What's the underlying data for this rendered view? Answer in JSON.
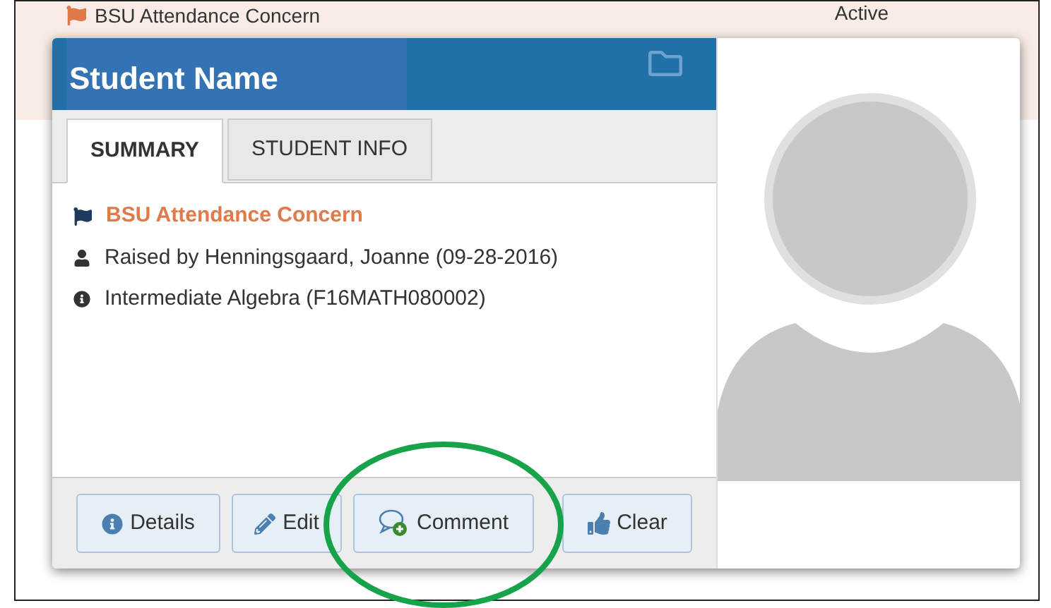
{
  "background_row": {
    "title": "BSU Attendance Concern",
    "status": "Active"
  },
  "popup": {
    "title": "Student Name",
    "tabs": [
      {
        "label": "SUMMARY",
        "selected": true
      },
      {
        "label": "STUDENT INFO",
        "selected": false
      }
    ],
    "summary": [
      {
        "kind": "flag",
        "text": "BSU Attendance Concern"
      },
      {
        "kind": "person",
        "text": "Raised by Henningsgaard, Joanne (09-28-2016)"
      },
      {
        "kind": "info",
        "text": "Intermediate Algebra (F16MATH080002)"
      }
    ],
    "buttons": [
      {
        "kind": "details",
        "label": "Details"
      },
      {
        "kind": "edit",
        "label": "Edit"
      },
      {
        "kind": "comment",
        "label": "Comment"
      },
      {
        "kind": "clear",
        "label": "Clear"
      }
    ]
  }
}
